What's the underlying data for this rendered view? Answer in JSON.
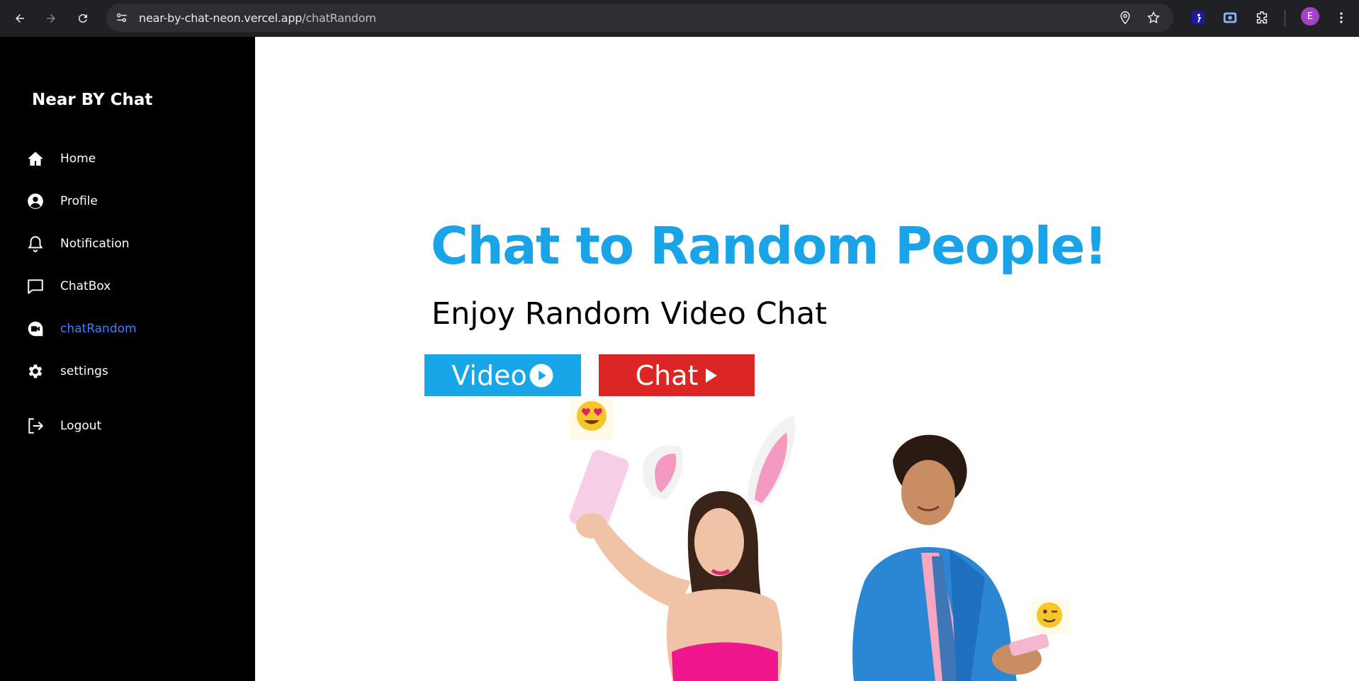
{
  "browser": {
    "url_host": "near-by-chat-neon.vercel.app",
    "url_path": "/chatRandom",
    "profile_initial": "E"
  },
  "sidebar": {
    "brand": "Near BY Chat",
    "items": [
      {
        "label": "Home",
        "icon": "home-icon"
      },
      {
        "label": "Profile",
        "icon": "user-circle-icon"
      },
      {
        "label": "Notification",
        "icon": "bell-icon"
      },
      {
        "label": "ChatBox",
        "icon": "chat-bubble-icon"
      },
      {
        "label": "chatRandom",
        "icon": "video-camera-icon",
        "active": true
      },
      {
        "label": "settings",
        "icon": "gear-icon"
      },
      {
        "label": "Logout",
        "icon": "logout-icon"
      }
    ]
  },
  "main": {
    "headline": "Chat to Random People!",
    "subline": "Enjoy Random Video Chat",
    "video_button": "Video",
    "chat_button": "Chat"
  },
  "colors": {
    "accent_blue": "#1aa3e6",
    "video_button": "#17a6e8",
    "chat_button": "#dc2626",
    "sidebar_bg": "#000000",
    "active_link": "#3b82f6"
  }
}
